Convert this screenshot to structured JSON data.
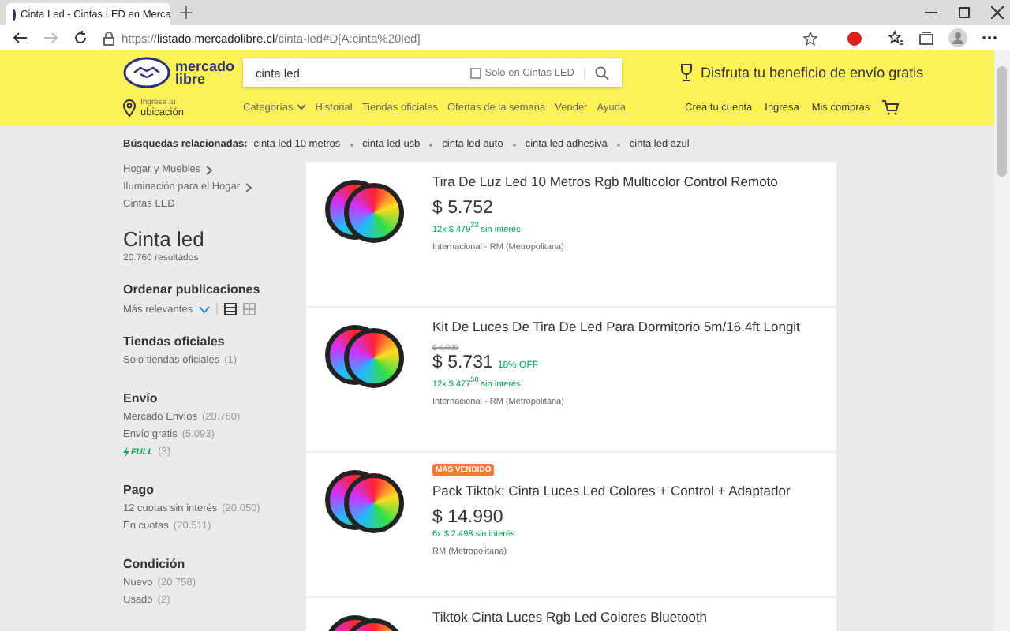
{
  "browser": {
    "tab_title": "Cinta Led - Cintas LED en Merca",
    "url": "https://**listado.mercadolibre.cl**/cinta-led#D[A:cinta%20led]"
  },
  "header": {
    "logo_line1": "mercado",
    "logo_line2": "libre",
    "search_value": "cinta led",
    "search_only_label": "Solo en Cintas LED",
    "search_only_checked": false,
    "promo": "Disfruta tu beneficio de envío gratis",
    "location_hint": "Ingresa tu",
    "location": "ubicación",
    "nav": [
      "Categorías",
      "Historial",
      "Tiendas oficiales",
      "Ofertas de la semana",
      "Vender",
      "Ayuda"
    ],
    "account": [
      "Crea tu cuenta",
      "Ingresa",
      "Mis compras"
    ]
  },
  "related": {
    "label": "Búsquedas relacionadas:",
    "items": [
      "cinta led 10 metros",
      "cinta led usb",
      "cinta led auto",
      "cinta led adhesiva",
      "cinta led azul"
    ]
  },
  "breadcrumb": [
    "Hogar y Muebles",
    "Iluminación para el Hogar",
    "Cintas LED"
  ],
  "title": "Cinta led",
  "results": "20.760 resultados",
  "sort": {
    "heading": "Ordenar publicaciones",
    "value": "Más relevantes",
    "views": [
      {
        "kind": "list",
        "selected": true
      },
      {
        "kind": "grid",
        "selected": false
      }
    ]
  },
  "filters": [
    {
      "heading": "Tiendas oficiales",
      "options": [
        {
          "label": "Solo tiendas oficiales",
          "count": "(1)",
          "kind": "text"
        }
      ]
    },
    {
      "heading": "Envío",
      "options": [
        {
          "label": "Mercado Envíos",
          "count": "(20.760)",
          "kind": "text"
        },
        {
          "label": "Envío gratis",
          "count": "(5.093)",
          "kind": "text"
        },
        {
          "label": "FULL",
          "count": "(3)",
          "kind": "full"
        }
      ]
    },
    {
      "heading": "Pago",
      "options": [
        {
          "label": "12 cuotas sin interés",
          "count": "(20.050)",
          "kind": "text"
        },
        {
          "label": "En cuotas",
          "count": "(20.511)",
          "kind": "text"
        }
      ]
    },
    {
      "heading": "Condición",
      "options": [
        {
          "label": "Nuevo",
          "count": "(20.758)",
          "kind": "text"
        },
        {
          "label": "Usado",
          "count": "(2)",
          "kind": "text"
        }
      ]
    }
  ],
  "products": [
    {
      "title": "Tira De Luz Led 10 Metros Rgb Multicolor Control Remoto",
      "price": "$ 5.752",
      "installments": "12x $ 479$^{33}$ sin interés",
      "location": "Internacional - RM (Metropolitana)"
    },
    {
      "title": "Kit De Luces De Tira De Led Para Dormitorio 5m/16.4ft Longit",
      "old_price": "$ 6.989",
      "price": "$ 5.731",
      "discount": "18% OFF",
      "installments": "12x $ 477$^{58}$ sin interés",
      "location": "Internacional - RM (Metropolitana)"
    },
    {
      "title": "Pack Tiktok: Cinta Luces Led Colores + Control + Adaptador",
      "badge": "MÁS VENDIDO",
      "price": "$ 14.990",
      "installments": "6x $ 2.498 sin interés",
      "location": "RM (Metropolitana)"
    },
    {
      "title": "Tiktok Cinta Luces Rgb Led Colores Bluetooth"
    }
  ]
}
